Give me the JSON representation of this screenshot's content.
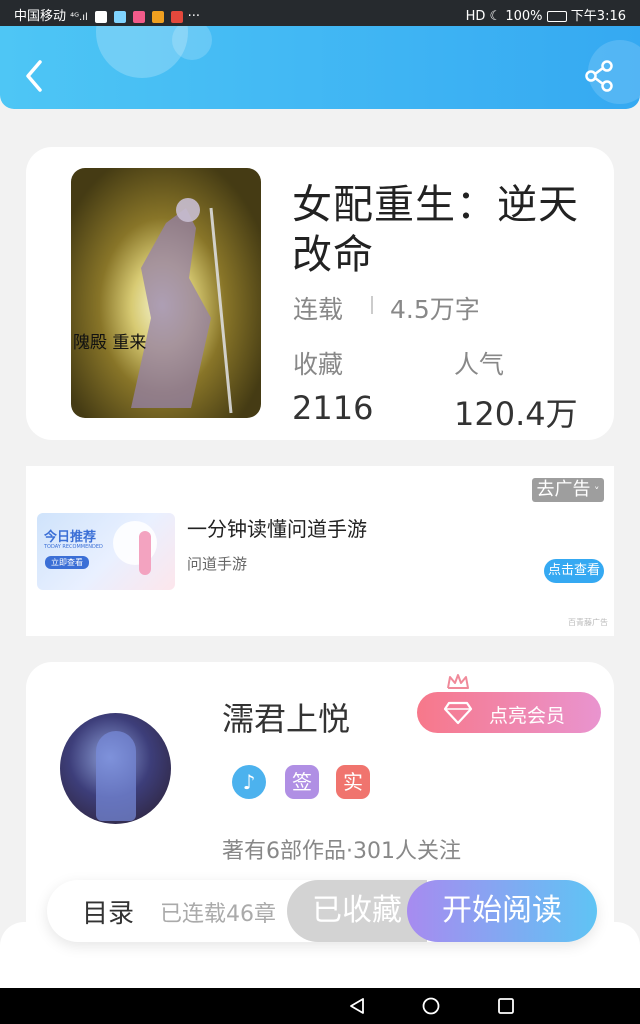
{
  "status_bar": {
    "carrier": "中国移动",
    "signal": "⁴ᴳ.ıl",
    "right_text": "HD ☾ 100%",
    "time": "下午3:16",
    "more": "···"
  },
  "header": {
    "back_icon": "chevron-left-icon",
    "share_icon": "share-icon",
    "accent": "#35a9f2"
  },
  "book": {
    "title": "女配重生：逆天改命",
    "status": "连载",
    "word_count": "4.5万字",
    "collect_label": "收藏",
    "collect_value": "2116",
    "popularity_label": "人气",
    "popularity_value": "120.4万",
    "cover_text": "隗殿  重来"
  },
  "ad": {
    "close_label": "去广告",
    "image_title": "今日推荐",
    "image_subtitle": "TODAY RECOMMENDED",
    "image_button": "立即查看",
    "title": "一分钟读懂问道手游",
    "subtitle": "问道手游",
    "button": "点击查看",
    "source": "百青藤广告"
  },
  "author": {
    "name": "濡君上悦",
    "vip_label": "点亮会员",
    "badges": [
      "♪",
      "签",
      "实"
    ],
    "stats": "著有6部作品·301人关注"
  },
  "bottom_bar": {
    "toc_label": "目录",
    "toc_count": "已连载46章",
    "collect_label": "已收藏",
    "read_label": "开始阅读"
  },
  "colors": {
    "header_start": "#4ec6f5",
    "header_end": "#35a9f2",
    "vip_start": "#f7788a",
    "vip_end": "#e994cf",
    "read_start": "#a78bf0",
    "read_end": "#5fc4f4"
  }
}
